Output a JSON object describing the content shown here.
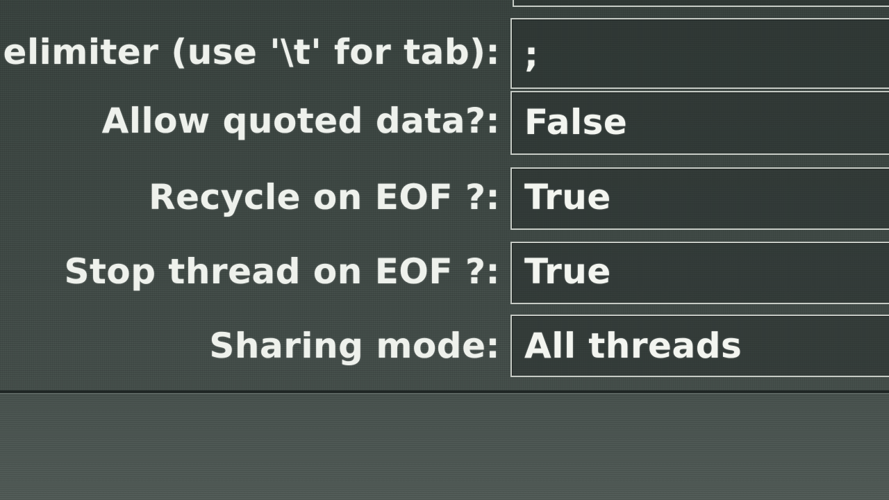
{
  "form": {
    "fields": [
      {
        "label": "elimiter (use '\\t' for tab):",
        "value": ";"
      },
      {
        "label": "Allow quoted data?:",
        "value": "False"
      },
      {
        "label": "Recycle on EOF ?:",
        "value": "True"
      },
      {
        "label": "Stop thread on EOF ?:",
        "value": "True"
      },
      {
        "label": "Sharing mode:",
        "value": "All threads"
      }
    ]
  }
}
